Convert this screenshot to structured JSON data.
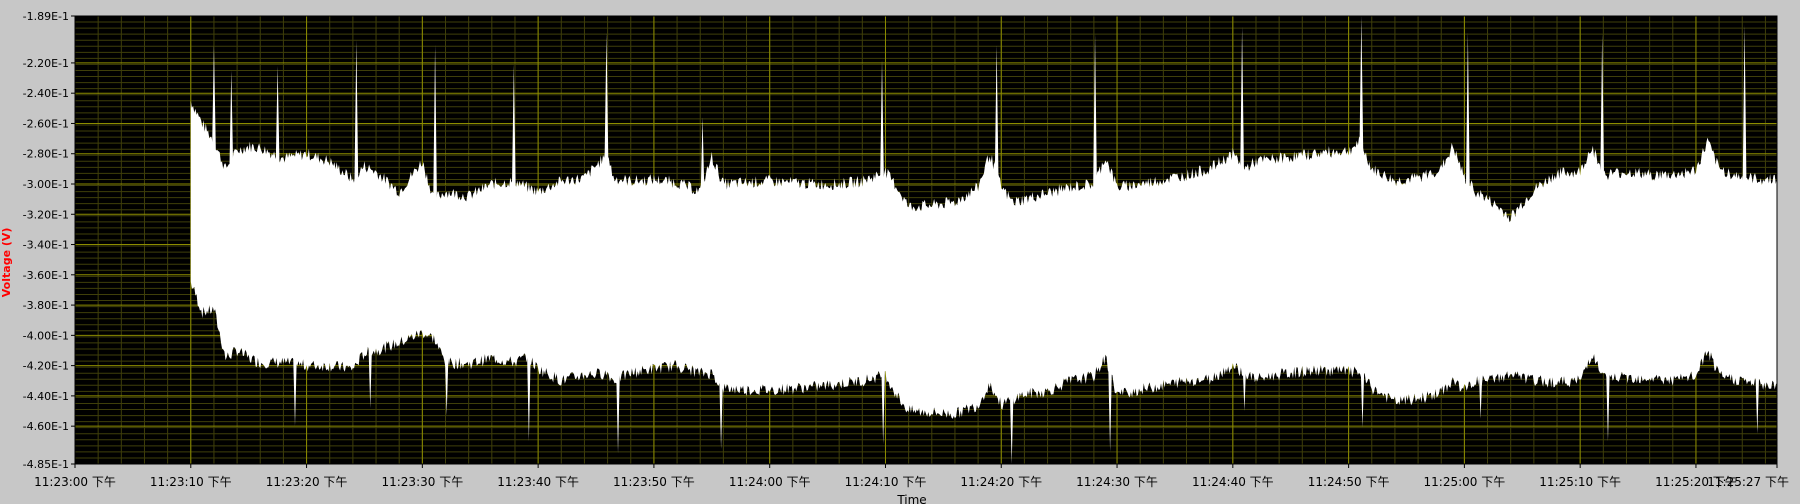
{
  "colors": {
    "frame": "#c7c7c7",
    "plot_background": "#000000",
    "grid_major": "#8c8c00",
    "grid_minor": "#3f3f0a",
    "signal": "#ffffff",
    "ylabel": "#ff0000",
    "tick_text": "#000000"
  },
  "chart_data": {
    "type": "area",
    "title": "",
    "xlabel": "Time",
    "ylabel": "Voltage (V)",
    "grid": true,
    "legend": "none",
    "xlim": [
      0,
      147
    ],
    "ylim": [
      -0.485,
      -0.189
    ],
    "x_ticks": [
      {
        "t": 0,
        "label": "11:23:00 下午"
      },
      {
        "t": 10,
        "label": "11:23:10 下午"
      },
      {
        "t": 20,
        "label": "11:23:20 下午"
      },
      {
        "t": 30,
        "label": "11:23:30 下午"
      },
      {
        "t": 40,
        "label": "11:23:40 下午"
      },
      {
        "t": 50,
        "label": "11:23:50 下午"
      },
      {
        "t": 60,
        "label": "11:24:00 下午"
      },
      {
        "t": 70,
        "label": "11:24:10 下午"
      },
      {
        "t": 80,
        "label": "11:24:20 下午"
      },
      {
        "t": 90,
        "label": "11:24:30 下午"
      },
      {
        "t": 100,
        "label": "11:24:40 下午"
      },
      {
        "t": 110,
        "label": "11:24:50 下午"
      },
      {
        "t": 120,
        "label": "11:25:00 下午"
      },
      {
        "t": 130,
        "label": "11:25:10 下午"
      },
      {
        "t": 140,
        "label": "11:25:20 下午"
      },
      {
        "t": 147,
        "label": "11:25:27 下午"
      }
    ],
    "y_ticks": [
      {
        "v": -0.189,
        "label": "-1.89E-1"
      },
      {
        "v": -0.22,
        "label": "-2.20E-1"
      },
      {
        "v": -0.24,
        "label": "-2.40E-1"
      },
      {
        "v": -0.26,
        "label": "-2.60E-1"
      },
      {
        "v": -0.28,
        "label": "-2.80E-1"
      },
      {
        "v": -0.3,
        "label": "-3.00E-1"
      },
      {
        "v": -0.32,
        "label": "-3.20E-1"
      },
      {
        "v": -0.34,
        "label": "-3.40E-1"
      },
      {
        "v": -0.36,
        "label": "-3.60E-1"
      },
      {
        "v": -0.38,
        "label": "-3.80E-1"
      },
      {
        "v": -0.4,
        "label": "-4.00E-1"
      },
      {
        "v": -0.42,
        "label": "-4.20E-1"
      },
      {
        "v": -0.44,
        "label": "-4.40E-1"
      },
      {
        "v": -0.46,
        "label": "-4.60E-1"
      },
      {
        "v": -0.485,
        "label": "-4.85E-1"
      }
    ],
    "series": [
      {
        "values": {
          "t": [
            10,
            11,
            12,
            13,
            14,
            15,
            16,
            18,
            20,
            22,
            24,
            25,
            26,
            28,
            30,
            31,
            32,
            34,
            36,
            38,
            39,
            40,
            42,
            44,
            46,
            46.5,
            48,
            50,
            52,
            54,
            55,
            56,
            58,
            60,
            62,
            64,
            66,
            68,
            70,
            71,
            72,
            74,
            76,
            78,
            79,
            80,
            81,
            82,
            84,
            86,
            88,
            89,
            90,
            92,
            94,
            96,
            98,
            100,
            101,
            102,
            104,
            106,
            108,
            110,
            111,
            112,
            114,
            116,
            118,
            119,
            120,
            121,
            122,
            124,
            126,
            128,
            130,
            131,
            132,
            134,
            136,
            138,
            140,
            141,
            142,
            144,
            146,
            147
          ],
          "upper": [
            -0.245,
            -0.26,
            -0.272,
            -0.29,
            -0.278,
            -0.275,
            -0.276,
            -0.283,
            -0.28,
            -0.285,
            -0.297,
            -0.288,
            -0.292,
            -0.305,
            -0.285,
            -0.31,
            -0.305,
            -0.308,
            -0.3,
            -0.298,
            -0.302,
            -0.305,
            -0.298,
            -0.296,
            -0.28,
            -0.296,
            -0.298,
            -0.297,
            -0.299,
            -0.305,
            -0.282,
            -0.3,
            -0.299,
            -0.298,
            -0.299,
            -0.3,
            -0.3,
            -0.298,
            -0.292,
            -0.302,
            -0.315,
            -0.314,
            -0.312,
            -0.302,
            -0.28,
            -0.302,
            -0.312,
            -0.31,
            -0.306,
            -0.302,
            -0.3,
            -0.282,
            -0.302,
            -0.3,
            -0.297,
            -0.294,
            -0.29,
            -0.28,
            -0.29,
            -0.285,
            -0.283,
            -0.281,
            -0.279,
            -0.278,
            -0.272,
            -0.29,
            -0.298,
            -0.296,
            -0.29,
            -0.275,
            -0.296,
            -0.305,
            -0.31,
            -0.322,
            -0.304,
            -0.293,
            -0.292,
            -0.275,
            -0.294,
            -0.292,
            -0.294,
            -0.294,
            -0.291,
            -0.272,
            -0.29,
            -0.296,
            -0.297,
            -0.296
          ],
          "lower": [
            -0.365,
            -0.385,
            -0.383,
            -0.415,
            -0.41,
            -0.415,
            -0.418,
            -0.418,
            -0.42,
            -0.42,
            -0.422,
            -0.412,
            -0.41,
            -0.405,
            -0.398,
            -0.402,
            -0.418,
            -0.419,
            -0.415,
            -0.418,
            -0.414,
            -0.422,
            -0.43,
            -0.426,
            -0.425,
            -0.43,
            -0.425,
            -0.422,
            -0.42,
            -0.425,
            -0.425,
            -0.435,
            -0.436,
            -0.436,
            -0.435,
            -0.434,
            -0.432,
            -0.43,
            -0.426,
            -0.44,
            -0.45,
            -0.451,
            -0.452,
            -0.446,
            -0.432,
            -0.446,
            -0.442,
            -0.439,
            -0.437,
            -0.43,
            -0.427,
            -0.415,
            -0.439,
            -0.436,
            -0.433,
            -0.43,
            -0.429,
            -0.42,
            -0.425,
            -0.429,
            -0.426,
            -0.424,
            -0.423,
            -0.424,
            -0.425,
            -0.435,
            -0.444,
            -0.442,
            -0.438,
            -0.43,
            -0.436,
            -0.43,
            -0.43,
            -0.426,
            -0.43,
            -0.431,
            -0.43,
            -0.412,
            -0.428,
            -0.428,
            -0.428,
            -0.43,
            -0.427,
            -0.41,
            -0.427,
            -0.43,
            -0.433,
            -0.432
          ]
        },
        "spikes_up": [
          [
            12,
            -0.208
          ],
          [
            13.5,
            -0.225
          ],
          [
            17.5,
            -0.222
          ],
          [
            24.3,
            -0.205
          ],
          [
            31.1,
            -0.208
          ],
          [
            37.9,
            -0.221
          ],
          [
            45.9,
            -0.2
          ],
          [
            54.2,
            -0.256
          ],
          [
            69.7,
            -0.218
          ],
          [
            79.6,
            -0.208
          ],
          [
            88.1,
            -0.201
          ],
          [
            100.8,
            -0.196
          ],
          [
            111.1,
            -0.189
          ],
          [
            120.3,
            -0.2
          ],
          [
            131.9,
            -0.201
          ],
          [
            144.2,
            -0.195
          ]
        ],
        "spikes_down": [
          [
            19,
            -0.46
          ],
          [
            25.5,
            -0.448
          ],
          [
            32.1,
            -0.453
          ],
          [
            39.2,
            -0.47
          ],
          [
            46.9,
            -0.478
          ],
          [
            55.8,
            -0.475
          ],
          [
            69.8,
            -0.472
          ],
          [
            80.9,
            -0.485
          ],
          [
            89.4,
            -0.477
          ],
          [
            101.0,
            -0.45
          ],
          [
            111.2,
            -0.461
          ],
          [
            121.4,
            -0.455
          ],
          [
            132.4,
            -0.47
          ],
          [
            145.3,
            -0.465
          ]
        ]
      }
    ]
  }
}
